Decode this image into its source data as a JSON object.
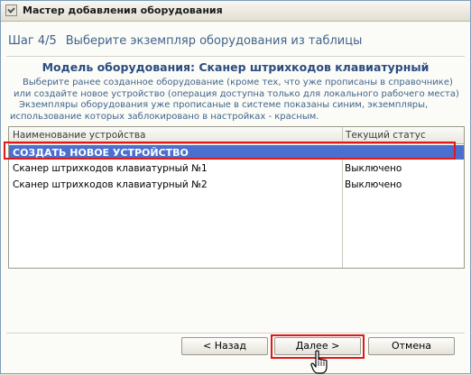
{
  "window": {
    "title": "Мастер добавления оборудования"
  },
  "step": {
    "number": "Шаг 4/5",
    "text": "Выберите экземпляр оборудования из таблицы"
  },
  "model_title": "Модель оборудования: Сканер штрихкодов клавиатурный",
  "description": {
    "line1": "Выберите ранее созданное оборудование (кроме тех, что уже прописаны в справочнике)",
    "line2": "или создайте новое устройство (операция доступна только для локального рабочего места)",
    "line3": "Экземпляры оборудования уже прописаные в системе показаны синим, экземпляры,",
    "line4": "использование которых заблокировано в настройках - красным."
  },
  "grid": {
    "columns": [
      "Наименование устройства",
      "Текущий статус"
    ],
    "rows": [
      {
        "name": "СОЗДАТЬ НОВОЕ УСТРОЙСТВО",
        "status": "",
        "selected": true
      },
      {
        "name": "Сканер штрихкодов клавиатурный №1",
        "status": "Выключено",
        "selected": false
      },
      {
        "name": "Сканер штрихкодов клавиатурный №2",
        "status": "Выключено",
        "selected": false
      }
    ]
  },
  "buttons": {
    "back": "< Назад",
    "next": "Далее >",
    "cancel": "Отмена"
  },
  "colors": {
    "selection": "#4a6fcf",
    "annotation_highlight": "#e01818",
    "step_text": "#40648c"
  }
}
